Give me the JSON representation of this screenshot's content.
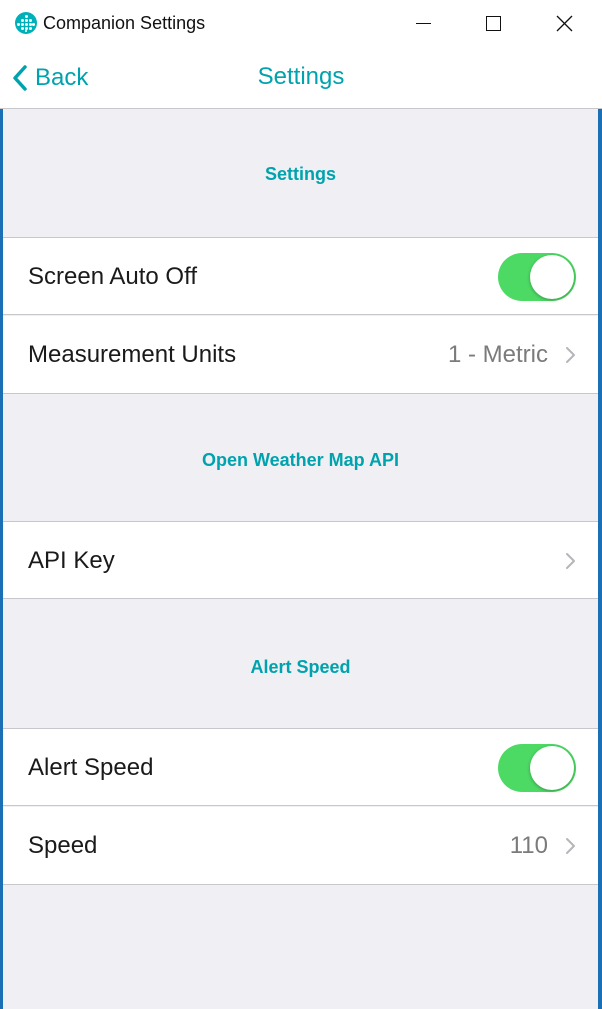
{
  "window": {
    "title": "Companion Settings",
    "controls": [
      "minimize",
      "maximize",
      "close"
    ]
  },
  "nav": {
    "back_label": "Back",
    "title": "Settings"
  },
  "sections": [
    {
      "header": "Settings",
      "rows": [
        {
          "label": "Screen Auto Off",
          "type": "toggle",
          "on": true
        },
        {
          "label": "Measurement Units",
          "type": "value",
          "value": "1 - Metric"
        }
      ]
    },
    {
      "header": "Open Weather Map API",
      "rows": [
        {
          "label": "API Key",
          "type": "link"
        }
      ]
    },
    {
      "header": "Alert Speed",
      "rows": [
        {
          "label": "Alert Speed",
          "type": "toggle",
          "on": true
        },
        {
          "label": "Speed",
          "type": "value",
          "value": "110"
        }
      ]
    }
  ],
  "icons": {
    "app": "fitbit-dots-icon",
    "back": "chevron-left-icon",
    "disclosure": "chevron-right-icon"
  },
  "colors": {
    "accent": "#00a3ad",
    "toggle_on": "#4cd964",
    "background": "#efeff4",
    "window_border": "#1b6fb5"
  }
}
